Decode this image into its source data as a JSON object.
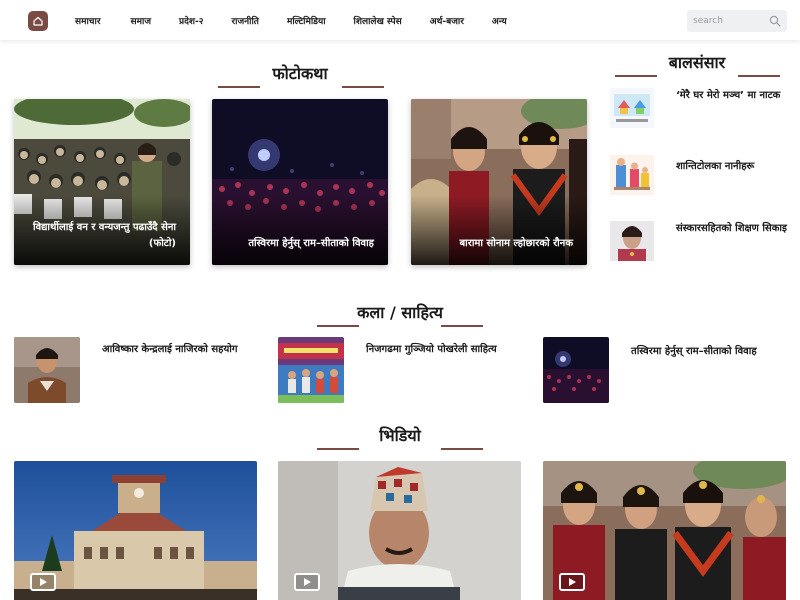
{
  "nav": {
    "items": [
      "समाचार",
      "समाज",
      "प्रदेश-२",
      "राजनीति",
      "मल्टिमिडिया",
      "शिलालेख स्पेस",
      "अर्थ-बजार",
      "अन्य"
    ],
    "search_placeholder": "search"
  },
  "photokatha": {
    "title": "फोटोकथा",
    "cards": [
      "विद्यार्थीलाई वन र वन्यजन्तु पढाउँदै सेना (फोटो)",
      "तस्विरमा हेर्नुस् राम–सीताको विवाह",
      "बारामा सोनाम ल्होछारको रौनक"
    ]
  },
  "balsansar": {
    "title": "बालसंसार",
    "items": [
      "‘मेरै घर मेरो मञ्च’ मा नाटक",
      "शान्तिटोलका नानीहरू",
      "संस्कारसहितको शिक्षण सिकाइ"
    ]
  },
  "kala": {
    "title": "कला / साहित्य",
    "items": [
      "आविष्कार केन्द्रलाई नाजिरको सहयोग",
      "निजगढमा गुञ्जियो पोखरेली साहित्य",
      "तस्विरमा हेर्नुस् राम–सीताको विवाह"
    ]
  },
  "video": {
    "title": "भिडियो"
  },
  "colors": {
    "accent": "#7a4b44",
    "search_bg": "#eef0f2"
  },
  "icons": [
    "home-icon",
    "search-icon",
    "play-icon"
  ]
}
